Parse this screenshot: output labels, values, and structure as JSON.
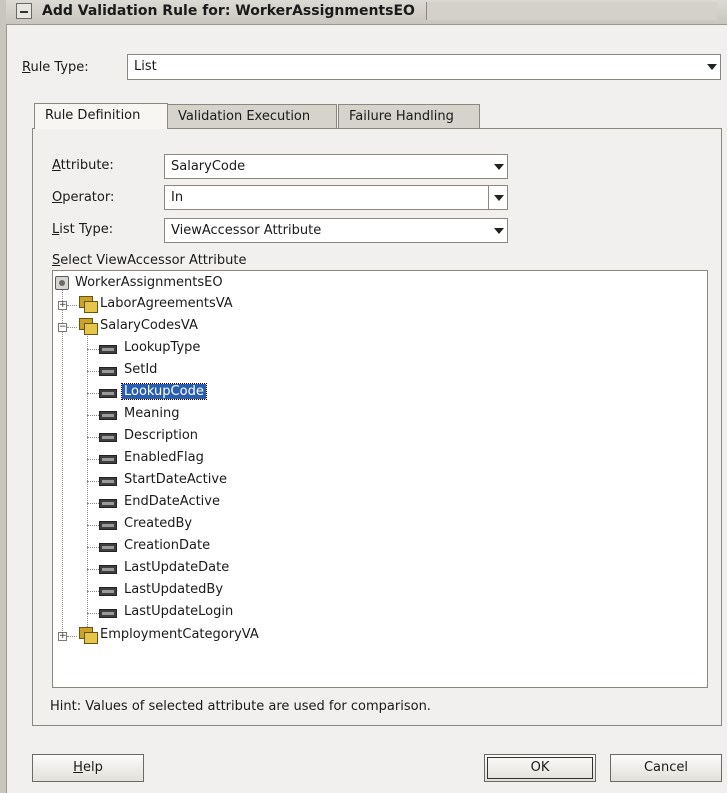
{
  "window": {
    "title": "Add Validation Rule for: WorkerAssignmentsEO"
  },
  "rule_type": {
    "label_mnemonic": "R",
    "label_rest": "ule Type:",
    "value": "List"
  },
  "tabs": [
    {
      "label": "Rule Definition"
    },
    {
      "label": "Validation Execution"
    },
    {
      "label": "Failure Handling"
    }
  ],
  "fields": {
    "attribute": {
      "label_mnemonic": "A",
      "label_rest": "ttribute:",
      "value": "SalaryCode"
    },
    "operator": {
      "label_mnemonic": "O",
      "label_rest": "perator:",
      "value": "In"
    },
    "list_type": {
      "label_mnemonic": "L",
      "label_rest": "ist Type:",
      "value": "ViewAccessor Attribute"
    }
  },
  "tree_label": {
    "mnemonic": "S",
    "rest": "elect ViewAccessor Attribute"
  },
  "tree": {
    "root": "WorkerAssignmentsEO",
    "va1": "LaborAgreementsVA",
    "va2": "SalaryCodesVA",
    "va3": "EmploymentCategoryVA",
    "attributes": [
      "LookupType",
      "SetId",
      "LookupCode",
      "Meaning",
      "Description",
      "EnabledFlag",
      "StartDateActive",
      "EndDateActive",
      "CreatedBy",
      "CreationDate",
      "LastUpdateDate",
      "LastUpdatedBy",
      "LastUpdateLogin"
    ],
    "selected": "LookupCode"
  },
  "hint": "Hint: Values of selected attribute are used for comparison.",
  "buttons": {
    "help_mnemonic": "H",
    "help_rest": "elp",
    "ok": "OK",
    "cancel": "Cancel"
  }
}
